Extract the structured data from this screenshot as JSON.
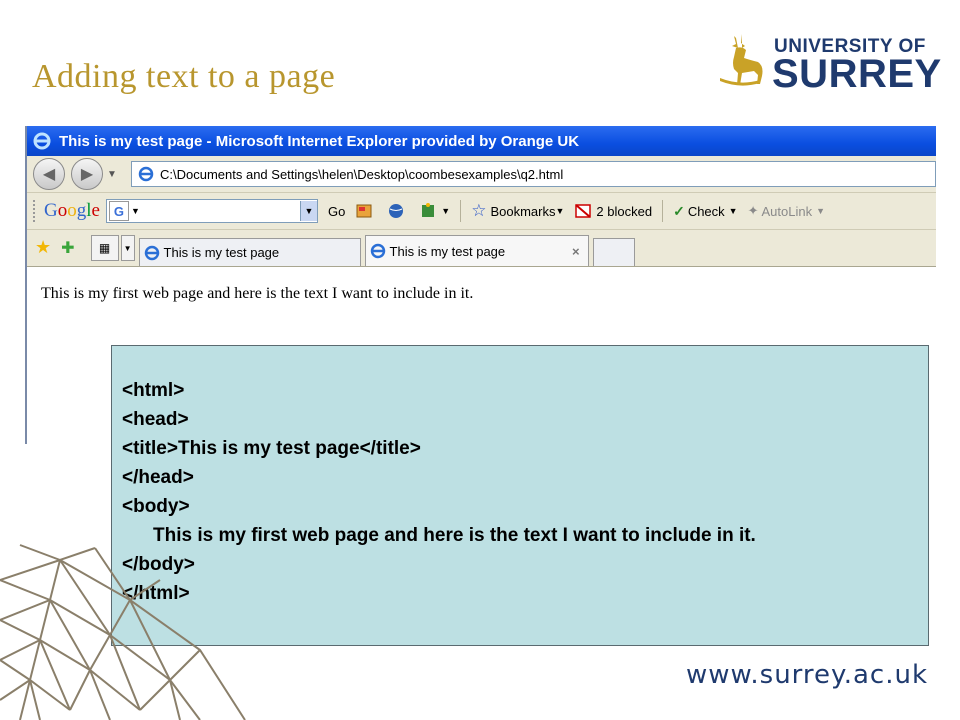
{
  "slide": {
    "title": "Adding text to a page",
    "footer_url": "www.surrey.ac.uk",
    "logo_line1": "UNIVERSITY OF",
    "logo_line2": "SURREY"
  },
  "browser": {
    "window_title": "This is my test page - Microsoft Internet Explorer provided by Orange UK",
    "address": "C:\\Documents and Settings\\helen\\Desktop\\coombesexamples\\q2.html",
    "google_label": "Google",
    "go_label": "Go",
    "bookmarks_label": "Bookmarks",
    "blocked_label": "2 blocked",
    "check_label": "Check",
    "autolink_label": "AutoLink",
    "tabs": [
      {
        "label": "This is my test page",
        "active": false
      },
      {
        "label": "This is my test page",
        "active": true,
        "close": "×"
      }
    ],
    "page_text": "This is my first web page and here is the text I want to include in it."
  },
  "code": {
    "lines": [
      "<html>",
      "<head>",
      "<title>This is my test page</title>",
      "</head>",
      "<body>",
      "This is my first web page and here is the text I want to include in it.",
      "</body>",
      "</html>"
    ]
  },
  "colors": {
    "title_gold": "#b8962e",
    "surrey_navy": "#1f3a6e",
    "ie_blue": "#0a4ee0",
    "code_bg": "#bde0e3"
  }
}
